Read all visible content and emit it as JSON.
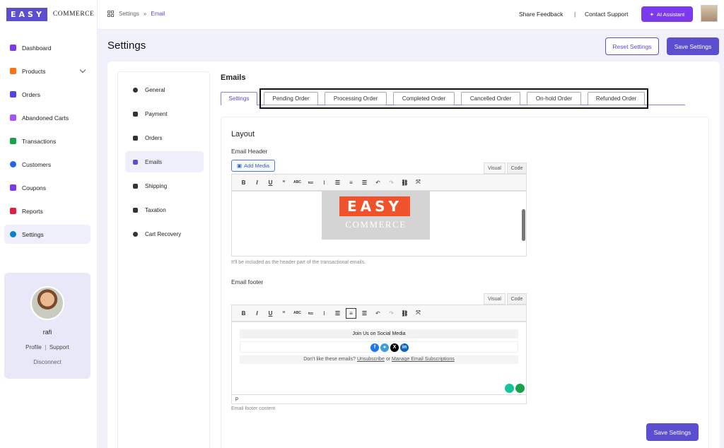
{
  "brand": {
    "logo_main": "EASY",
    "logo_sub": "COMMERCE"
  },
  "breadcrumb": {
    "parent": "Settings",
    "separator": "»",
    "current": "Email"
  },
  "header": {
    "share_feedback": "Share Feedback",
    "separator": "|",
    "contact_support": "Contact Support",
    "ai_assistant": "AI Assistant"
  },
  "sidebar": {
    "items": [
      {
        "label": "Dashboard",
        "color": "#7c3aed"
      },
      {
        "label": "Products",
        "color": "#f97316"
      },
      {
        "label": "Orders",
        "color": "#4f46e5"
      },
      {
        "label": "Abandoned Carts",
        "color": "#a855f7"
      },
      {
        "label": "Transactions",
        "color": "#16a34a"
      },
      {
        "label": "Customers",
        "color": "#2563eb"
      },
      {
        "label": "Coupons",
        "color": "#7c3aed"
      },
      {
        "label": "Reports",
        "color": "#e11d48"
      },
      {
        "label": "Settings",
        "color": "#0284c7"
      }
    ],
    "active": "Settings"
  },
  "profile": {
    "name": "rafi",
    "profile_link": "Profile",
    "support_link": "Support",
    "disconnect": "Disconnect"
  },
  "page": {
    "title": "Settings",
    "reset_label": "Reset Settings",
    "save_label": "Save Settings"
  },
  "settings_nav": {
    "items": [
      "General",
      "Payment",
      "Orders",
      "Emails",
      "Shipping",
      "Taxation",
      "Cart Recovery"
    ],
    "active": "Emails"
  },
  "emails": {
    "title": "Emails",
    "tabs": [
      "Settings",
      "Pending Order",
      "Processing Order",
      "Completed Order",
      "Cancelled Order",
      "On-hold Order",
      "Refunded Order"
    ],
    "active_tab": "Settings"
  },
  "layout": {
    "title": "Layout",
    "email_header_label": "Email Header",
    "add_media": "Add Media",
    "visual_tab": "Visual",
    "code_tab": "Code",
    "header_logo_main": "EASY",
    "header_logo_sub": "COMMERCE",
    "header_hint": "It'll be included as the header part of the transactional emails.",
    "email_footer_label": "Email footer",
    "footer_social_title": "Join Us on Social Media",
    "footer_unsub_prefix": "Don't like these emails?",
    "footer_unsubscribe": "Unsubscribe",
    "footer_or": "or",
    "footer_manage": "Manage Email Subscriptions",
    "footer_status_path": "p",
    "footer_hint": "Email footer content",
    "save_label": "Save Settings"
  },
  "toolbar_icons": [
    "bold-icon",
    "italic-icon",
    "underline-icon",
    "quote-icon",
    "strikethrough-icon",
    "bullet-list-icon",
    "numbered-list-icon",
    "align-left-icon",
    "align-center-icon",
    "align-right-icon",
    "undo-icon",
    "redo-icon",
    "link-icon",
    "fullscreen-icon"
  ],
  "social_icons": [
    "facebook-icon",
    "community-icon",
    "x-icon",
    "linkedin-icon"
  ]
}
